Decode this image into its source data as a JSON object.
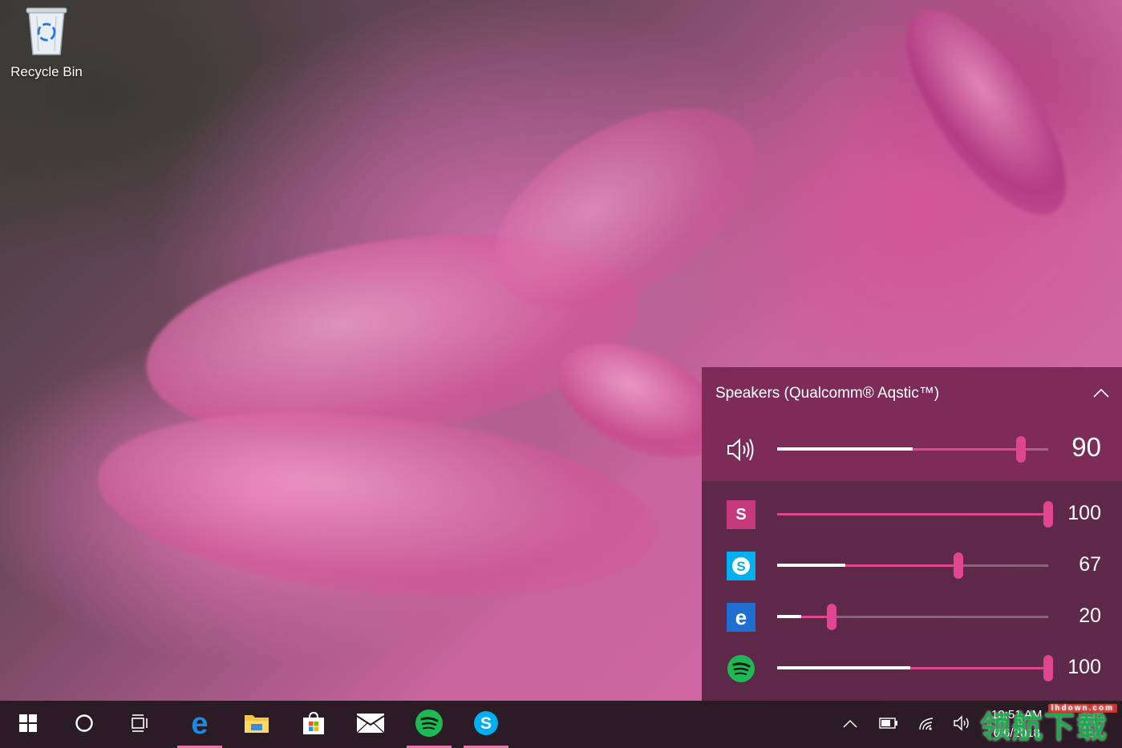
{
  "desktop": {
    "recycle_bin_label": "Recycle Bin",
    "recycle_bin_icon": "recycle-bin-icon"
  },
  "volume_flyout": {
    "device_name": "Speakers (Qualcomm® Aqstic™)",
    "collapse_icon": "chevron-up-icon",
    "accent_color": "#e0458f",
    "master": {
      "icon": "speaker-icon",
      "value": "90",
      "level": 0.9,
      "peak": 0.5
    },
    "apps": [
      {
        "name": "S",
        "icon": "app-s-icon",
        "value": "100",
        "level": 1.0,
        "peak": 0,
        "tile_color": "#c63a7d"
      },
      {
        "name": "Skype",
        "icon": "skype-icon",
        "value": "67",
        "level": 0.67,
        "peak": 0.25,
        "tile_color": "#00aff0"
      },
      {
        "name": "Edge",
        "icon": "edge-icon",
        "value": "20",
        "level": 0.2,
        "peak": 0.09,
        "tile_color": "#1e6fd0"
      },
      {
        "name": "Spotify",
        "icon": "spotify-icon",
        "value": "100",
        "level": 1.0,
        "peak": 0.49,
        "tile_color": "#1db954"
      }
    ]
  },
  "taskbar": {
    "items": [
      {
        "icon": "windows-start-icon"
      },
      {
        "icon": "cortana-icon"
      },
      {
        "icon": "task-view-icon"
      },
      {
        "icon": "edge-icon",
        "active": true
      },
      {
        "icon": "file-explorer-icon"
      },
      {
        "icon": "store-icon"
      },
      {
        "icon": "mail-icon"
      },
      {
        "icon": "spotify-icon",
        "active": true
      },
      {
        "icon": "skype-icon",
        "active": true
      }
    ],
    "tray": {
      "chevron_icon": "chevron-up-icon",
      "battery_icon": "battery-icon",
      "wifi_icon": "wifi-icon",
      "volume_icon": "volume-icon",
      "time": "10:51 AM",
      "date": "6/6/2018"
    }
  },
  "watermark": {
    "text": "领航下载",
    "tag": "lhdown.com"
  }
}
